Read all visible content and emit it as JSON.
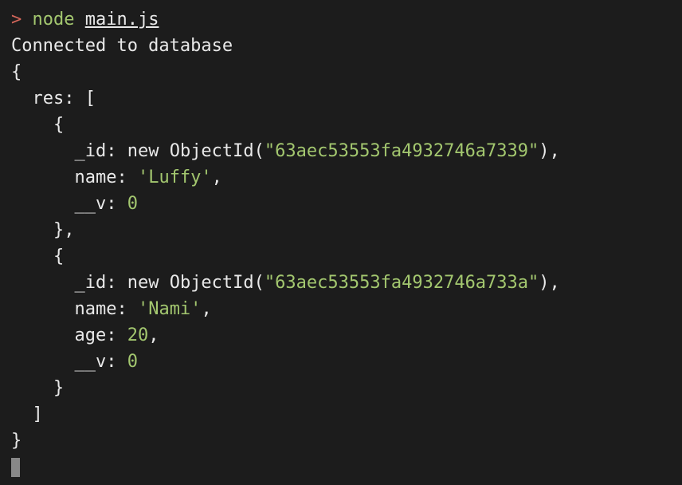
{
  "prompt": {
    "symbol": ">",
    "node": "node",
    "file": "main.js"
  },
  "output": {
    "connected": "Connected to database",
    "open_brace": "{",
    "res_label": "  res: [",
    "obj1_open": "    {",
    "obj1_id_key": "      _id: ",
    "obj1_id_new": "new",
    "obj1_id_class": " ObjectId(",
    "obj1_id_value": "\"63aec53553fa4932746a7339\"",
    "obj1_id_close": "),",
    "obj1_name_key": "      name: ",
    "obj1_name_value": "'Luffy'",
    "obj1_name_comma": ",",
    "obj1_v_key": "      __v: ",
    "obj1_v_value": "0",
    "obj1_close": "    },",
    "obj2_open": "    {",
    "obj2_id_key": "      _id: ",
    "obj2_id_new": "new",
    "obj2_id_class": " ObjectId(",
    "obj2_id_value": "\"63aec53553fa4932746a733a\"",
    "obj2_id_close": "),",
    "obj2_name_key": "      name: ",
    "obj2_name_value": "'Nami'",
    "obj2_name_comma": ",",
    "obj2_age_key": "      age: ",
    "obj2_age_value": "20",
    "obj2_age_comma": ",",
    "obj2_v_key": "      __v: ",
    "obj2_v_value": "0",
    "obj2_close": "    }",
    "array_close": "  ]",
    "close_brace": "}"
  }
}
